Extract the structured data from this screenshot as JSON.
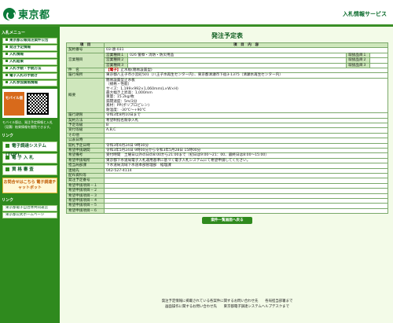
{
  "header": {
    "logo_text": "東京都",
    "service_name": "入札情報サービス"
  },
  "sidebar": {
    "menu_title": "入札メニュー",
    "menu_items": [
      "東京都公報発注案件公告",
      "発注予定情報",
      "入札情報",
      "入札結果",
      "入札手続・手続方法",
      "電子入札の手続き",
      "入札参加資格情報"
    ],
    "mobile_badge": "モバイル版",
    "mobile_note": "モバイル版は、発注予定情報と入札（見積）結果情報を閲覧できます。",
    "link_title": "リンク",
    "big_buttons": [
      "電子調達システム(TOP)",
      "電 子 入 札",
      "資 格 審 査"
    ],
    "inquiry": "お問合せはこちら 電子調達チャットボット",
    "footer_title": "リンク",
    "footer_links": [
      "東京都電子自治体共同運営",
      "東京都公式ホームページ"
    ]
  },
  "main": {
    "title": "発注予定表",
    "col_item": "項　目",
    "col_content": "項　目　内　容",
    "rows": {
      "contract_no_label": "契約番号",
      "contract_no": "03-遠-031",
      "business_label": "営業種目",
      "business_1_label": "営業種目１",
      "business_1": "026 警察・消防・防災用品",
      "business_2_label": "営業種目２",
      "business_3_label": "営業種目３",
      "order_1_label": "取扱品目１",
      "order_2_label": "取扱品目２",
      "order_3_label": "取扱品目３",
      "name_label": "件　名",
      "name_tag": "【電子】",
      "name_value": "止水板(簡易設置型)",
      "location_label": "履行場所",
      "location_value": "東京都八王子市小宮町501（八王子水再生センター内）、東京都清瀬市下宿3-1375（清瀬水再生センター内）",
      "summary_label": "概要",
      "summary_lines": [
        "簡易設置型止水板",
        "（規格・性能）",
        "サイズ：1,199×992×1,060mm(L×W×H)",
        "最大幅き上昇高：1,000mm",
        "重量：15.2kg/枚",
        "漏閉速度：5m/3分",
        "素材：PP(ポリプロピレン)",
        "耐温度：-30℃～+90℃"
      ],
      "period_label": "履行期限",
      "period_value": "令和3年8月10日まで",
      "method_label": "契約方法",
      "method_value": "希望制指名競争入札",
      "grade_label": "予定等級",
      "grade_value": "B",
      "accept_label": "受付等級",
      "accept_value": "A,B,C",
      "other_label": "その他",
      "other_value": "",
      "announce_label": "公表日時",
      "announce_value": "",
      "open_label": "開札予定日時",
      "open_value": "令和3年6月24日 9時30分",
      "apply_period_label": "希望申請期間",
      "apply_period_value": "令和3年5月24日 9時00分から令和3年5月28日 15時00分",
      "remarks_label": "希望備考",
      "remarks_value": "受付時間　土曜日以外の日の8:00から21:00まで（初日は9:00～21：00、最終日は8:00～15:00）",
      "apply_place_label": "希望申請場所",
      "apply_place_value": "東京都下水道局電子入札運用基準に基づく電子入札システムにて希望申請してください。",
      "dept_label": "担当局部課",
      "dept_value": "下水道局流域下水道本部管理部　経理課",
      "contact_label": "連絡先",
      "contact_value": "042-527-4114",
      "attach_label": "配布資料等",
      "attach_value": "",
      "number_label": "発注予定番号",
      "number_value": "",
      "apply_items": [
        "希望申請項目－１",
        "希望申請項目－２",
        "希望申請項目－３",
        "希望申請項目－４",
        "希望申請項目－５",
        "希望申請項目－６"
      ]
    },
    "back_button": "案件一覧画面へ戻る"
  },
  "footer": {
    "line_1": "発注予定情報に掲載されている各案件に関するお問い合わせ先　　各局担当部署まで",
    "line_2": "画面操作に関するお問い合わせ先　　東京都電子調達システムヘルプデスクまで"
  }
}
